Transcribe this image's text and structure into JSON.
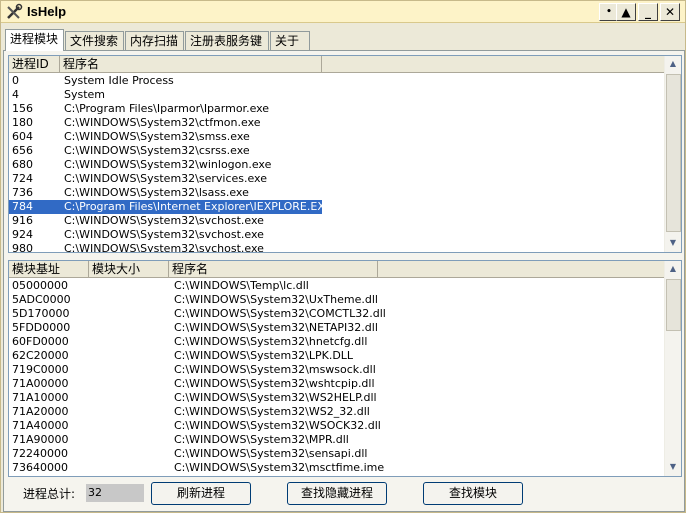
{
  "window": {
    "title": "IsHelp",
    "controls": {
      "extra": "•",
      "up": "▲",
      "minimize": "_",
      "close": "✕"
    }
  },
  "tabs": [
    {
      "label": "进程模块",
      "active": true
    },
    {
      "label": "文件搜索",
      "active": false
    },
    {
      "label": "内存扫描",
      "active": false
    },
    {
      "label": "注册表服务键",
      "active": false
    },
    {
      "label": "关于",
      "active": false
    }
  ],
  "process_list": {
    "columns": [
      "进程ID",
      "程序名"
    ],
    "rows": [
      {
        "pid": "0",
        "name": "System Idle Process"
      },
      {
        "pid": "4",
        "name": "System"
      },
      {
        "pid": "156",
        "name": "C:\\Program Files\\Iparmor\\Iparmor.exe"
      },
      {
        "pid": "180",
        "name": "C:\\WINDOWS\\System32\\ctfmon.exe"
      },
      {
        "pid": "604",
        "name": "C:\\WINDOWS\\System32\\smss.exe"
      },
      {
        "pid": "656",
        "name": "C:\\WINDOWS\\System32\\csrss.exe"
      },
      {
        "pid": "680",
        "name": "C:\\WINDOWS\\System32\\winlogon.exe"
      },
      {
        "pid": "724",
        "name": "C:\\WINDOWS\\System32\\services.exe"
      },
      {
        "pid": "736",
        "name": "C:\\WINDOWS\\System32\\lsass.exe"
      },
      {
        "pid": "784",
        "name": "C:\\Program Files\\Internet Explorer\\IEXPLORE.EXE",
        "selected": true
      },
      {
        "pid": "916",
        "name": "C:\\WINDOWS\\System32\\svchost.exe"
      },
      {
        "pid": "924",
        "name": "C:\\WINDOWS\\System32\\svchost.exe"
      },
      {
        "pid": "980",
        "name": "C:\\WINDOWS\\System32\\svchost.exe"
      }
    ]
  },
  "module_list": {
    "columns": [
      "模块基址",
      "模块大小",
      "程序名"
    ],
    "rows": [
      {
        "base": "05000000",
        "size": "",
        "name": "C:\\WINDOWS\\Temp\\lc.dll"
      },
      {
        "base": "5ADC0000",
        "size": "",
        "name": "C:\\WINDOWS\\System32\\UxTheme.dll"
      },
      {
        "base": "5D170000",
        "size": "",
        "name": "C:\\WINDOWS\\System32\\COMCTL32.dll"
      },
      {
        "base": "5FDD0000",
        "size": "",
        "name": "C:\\WINDOWS\\System32\\NETAPI32.dll"
      },
      {
        "base": "60FD0000",
        "size": "",
        "name": "C:\\WINDOWS\\System32\\hnetcfg.dll"
      },
      {
        "base": "62C20000",
        "size": "",
        "name": "C:\\WINDOWS\\System32\\LPK.DLL"
      },
      {
        "base": "719C0000",
        "size": "",
        "name": "C:\\WINDOWS\\System32\\mswsock.dll"
      },
      {
        "base": "71A00000",
        "size": "",
        "name": "C:\\WINDOWS\\System32\\wshtcpip.dll"
      },
      {
        "base": "71A10000",
        "size": "",
        "name": "C:\\WINDOWS\\System32\\WS2HELP.dll"
      },
      {
        "base": "71A20000",
        "size": "",
        "name": "C:\\WINDOWS\\System32\\WS2_32.dll"
      },
      {
        "base": "71A40000",
        "size": "",
        "name": "C:\\WINDOWS\\System32\\WSOCK32.dll"
      },
      {
        "base": "71A90000",
        "size": "",
        "name": "C:\\WINDOWS\\System32\\MPR.dll"
      },
      {
        "base": "72240000",
        "size": "",
        "name": "C:\\WINDOWS\\System32\\sensapi.dll"
      },
      {
        "base": "73640000",
        "size": "",
        "name": "C:\\WINDOWS\\System32\\msctfime.ime"
      }
    ]
  },
  "footer": {
    "count_label": "进程总计:",
    "count_value": "32",
    "refresh_button": "刷新进程",
    "find_hidden_button": "查找隐藏进程",
    "find_module_button": "查找模块"
  },
  "colors": {
    "titlebar": "#fdf3c8",
    "selection": "#316ac5",
    "window_bg": "#ece9d8"
  }
}
